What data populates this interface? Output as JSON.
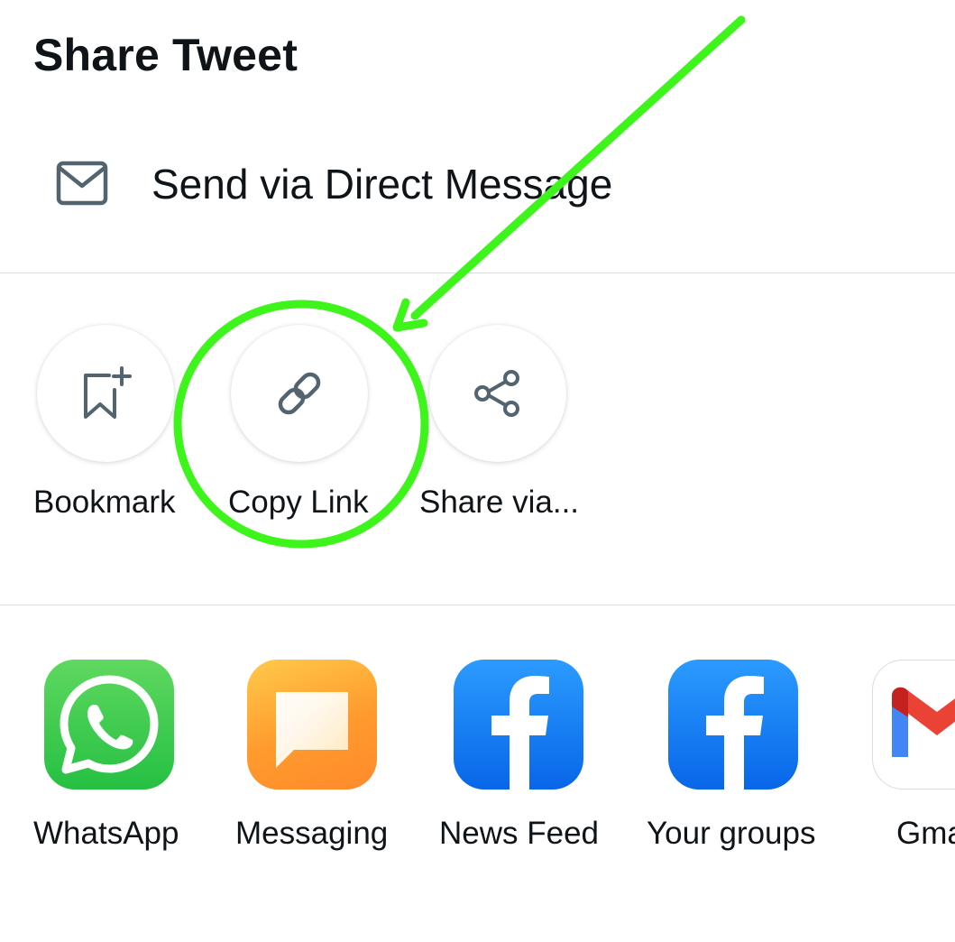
{
  "header": {
    "title": "Share Tweet"
  },
  "direct_message": {
    "icon": "envelope-icon",
    "label": "Send via Direct Message"
  },
  "actions": [
    {
      "icon": "bookmark-add-icon",
      "label": "Bookmark"
    },
    {
      "icon": "link-icon",
      "label": "Copy Link"
    },
    {
      "icon": "share-icon",
      "label": "Share via..."
    }
  ],
  "apps": [
    {
      "icon": "whatsapp-icon",
      "label": "WhatsApp",
      "color": "#2ecc52"
    },
    {
      "icon": "messaging-icon",
      "label": "Messaging",
      "color": "#ff9f2e"
    },
    {
      "icon": "facebook-icon",
      "label": "News Feed",
      "color": "#1877f2"
    },
    {
      "icon": "facebook-icon",
      "label": "Your groups",
      "color": "#1877f2"
    },
    {
      "icon": "gmail-icon",
      "label": "Gmail",
      "color": "#ea4335"
    }
  ],
  "annotation": {
    "highlight_color": "#3df51b",
    "target": "Copy Link"
  },
  "colors": {
    "icon_gray": "#536471",
    "text": "#0f1419",
    "divider": "#d9dde0"
  }
}
